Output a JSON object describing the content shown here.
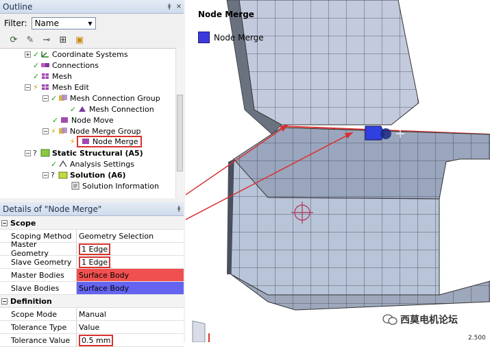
{
  "outline": {
    "title": "Outline",
    "pin": "ǂ",
    "close": "×",
    "filter_label": "Filter:",
    "filter_value": "Name",
    "tree": [
      {
        "label": "Coordinate Systems",
        "bold": false
      },
      {
        "label": "Connections",
        "bold": false
      },
      {
        "label": "Mesh",
        "bold": false
      },
      {
        "label": "Mesh Edit",
        "bold": false
      },
      {
        "label": "Mesh Connection Group",
        "bold": false
      },
      {
        "label": "Mesh Connection",
        "bold": false
      },
      {
        "label": "Node Move",
        "bold": false
      },
      {
        "label": "Node Merge Group",
        "bold": false
      },
      {
        "label": "Node Merge",
        "bold": false
      },
      {
        "label": "Static Structural (A5)",
        "bold": true
      },
      {
        "label": "Analysis Settings",
        "bold": false
      },
      {
        "label": "Solution (A6)",
        "bold": true
      },
      {
        "label": "Solution Information",
        "bold": false
      }
    ]
  },
  "details": {
    "title": "Details of \"Node Merge\"",
    "scope_section": "Scope",
    "scoping_method_key": "Scoping Method",
    "scoping_method_val": "Geometry Selection",
    "master_geometry_key": "Master Geometry",
    "master_geometry_val": "1 Edge",
    "slave_geometry_key": "Slave Geometry",
    "slave_geometry_val": "1 Edge",
    "master_bodies_key": "Master Bodies",
    "master_bodies_val": "Surface Body",
    "slave_bodies_key": "Slave Bodies",
    "slave_bodies_val": "Surface Body",
    "definition_section": "Definition",
    "scope_mode_key": "Scope Mode",
    "scope_mode_val": "Manual",
    "tolerance_type_key": "Tolerance Type",
    "tolerance_type_val": "Value",
    "tolerance_value_key": "Tolerance Value",
    "tolerance_value_val": "0.5 mm"
  },
  "viewport": {
    "title": "Node Merge",
    "legend": "Node Merge",
    "watermark": "西莫电机论坛",
    "scale_value": "2.500"
  },
  "colors": {
    "master_bodies": "#f05050",
    "slave_bodies": "#6464f0",
    "highlight": "#d9312b",
    "mesh_face": "#b8c4d8"
  }
}
